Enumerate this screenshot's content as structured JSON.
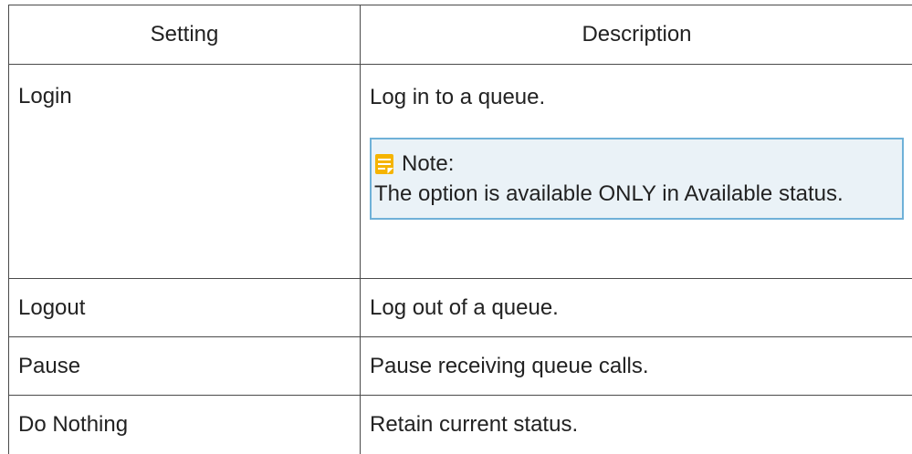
{
  "table": {
    "headers": {
      "setting": "Setting",
      "description": "Description"
    },
    "rows": [
      {
        "setting": "Login",
        "description": "Log in to a queue.",
        "note": {
          "icon": "note-icon",
          "label": "Note:",
          "text": "The option is available ONLY in Available status."
        }
      },
      {
        "setting": "Logout",
        "description": "Log out of a queue."
      },
      {
        "setting": "Pause",
        "description": "Pause receiving queue calls."
      },
      {
        "setting": "Do Nothing",
        "description": "Retain current status."
      }
    ]
  },
  "colors": {
    "border": "#4a4a4a",
    "note_background": "#eaf2f7",
    "note_border": "#6fb1d8",
    "note_icon": "#f5b400"
  }
}
